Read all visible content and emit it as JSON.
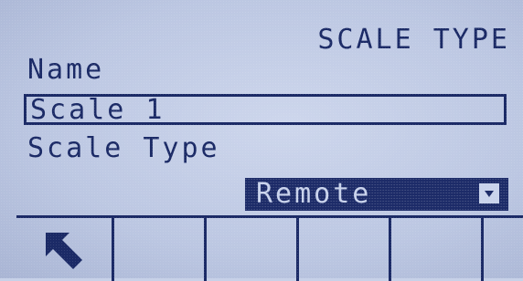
{
  "screen": {
    "title": "SCALE TYPE"
  },
  "form": {
    "name_label": "Name",
    "name_value": "Scale 1",
    "scale_type_label": "Scale Type",
    "scale_type_value": "Remote"
  },
  "softkeys": [
    {
      "icon": "back-arrow-icon"
    },
    {
      "icon": ""
    },
    {
      "icon": ""
    },
    {
      "icon": ""
    },
    {
      "icon": ""
    }
  ],
  "colors": {
    "background": "#c7d1e8",
    "foreground": "#1b2a66"
  }
}
